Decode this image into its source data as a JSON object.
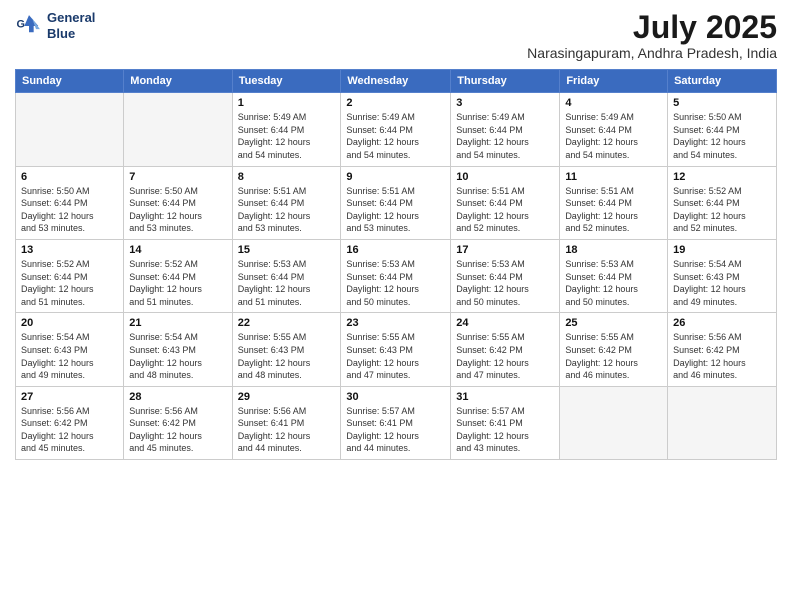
{
  "logo": {
    "line1": "General",
    "line2": "Blue"
  },
  "title": "July 2025",
  "location": "Narasingapuram, Andhra Pradesh, India",
  "days_of_week": [
    "Sunday",
    "Monday",
    "Tuesday",
    "Wednesday",
    "Thursday",
    "Friday",
    "Saturday"
  ],
  "weeks": [
    [
      {
        "day": "",
        "info": ""
      },
      {
        "day": "",
        "info": ""
      },
      {
        "day": "1",
        "info": "Sunrise: 5:49 AM\nSunset: 6:44 PM\nDaylight: 12 hours\nand 54 minutes."
      },
      {
        "day": "2",
        "info": "Sunrise: 5:49 AM\nSunset: 6:44 PM\nDaylight: 12 hours\nand 54 minutes."
      },
      {
        "day": "3",
        "info": "Sunrise: 5:49 AM\nSunset: 6:44 PM\nDaylight: 12 hours\nand 54 minutes."
      },
      {
        "day": "4",
        "info": "Sunrise: 5:49 AM\nSunset: 6:44 PM\nDaylight: 12 hours\nand 54 minutes."
      },
      {
        "day": "5",
        "info": "Sunrise: 5:50 AM\nSunset: 6:44 PM\nDaylight: 12 hours\nand 54 minutes."
      }
    ],
    [
      {
        "day": "6",
        "info": "Sunrise: 5:50 AM\nSunset: 6:44 PM\nDaylight: 12 hours\nand 53 minutes."
      },
      {
        "day": "7",
        "info": "Sunrise: 5:50 AM\nSunset: 6:44 PM\nDaylight: 12 hours\nand 53 minutes."
      },
      {
        "day": "8",
        "info": "Sunrise: 5:51 AM\nSunset: 6:44 PM\nDaylight: 12 hours\nand 53 minutes."
      },
      {
        "day": "9",
        "info": "Sunrise: 5:51 AM\nSunset: 6:44 PM\nDaylight: 12 hours\nand 53 minutes."
      },
      {
        "day": "10",
        "info": "Sunrise: 5:51 AM\nSunset: 6:44 PM\nDaylight: 12 hours\nand 52 minutes."
      },
      {
        "day": "11",
        "info": "Sunrise: 5:51 AM\nSunset: 6:44 PM\nDaylight: 12 hours\nand 52 minutes."
      },
      {
        "day": "12",
        "info": "Sunrise: 5:52 AM\nSunset: 6:44 PM\nDaylight: 12 hours\nand 52 minutes."
      }
    ],
    [
      {
        "day": "13",
        "info": "Sunrise: 5:52 AM\nSunset: 6:44 PM\nDaylight: 12 hours\nand 51 minutes."
      },
      {
        "day": "14",
        "info": "Sunrise: 5:52 AM\nSunset: 6:44 PM\nDaylight: 12 hours\nand 51 minutes."
      },
      {
        "day": "15",
        "info": "Sunrise: 5:53 AM\nSunset: 6:44 PM\nDaylight: 12 hours\nand 51 minutes."
      },
      {
        "day": "16",
        "info": "Sunrise: 5:53 AM\nSunset: 6:44 PM\nDaylight: 12 hours\nand 50 minutes."
      },
      {
        "day": "17",
        "info": "Sunrise: 5:53 AM\nSunset: 6:44 PM\nDaylight: 12 hours\nand 50 minutes."
      },
      {
        "day": "18",
        "info": "Sunrise: 5:53 AM\nSunset: 6:44 PM\nDaylight: 12 hours\nand 50 minutes."
      },
      {
        "day": "19",
        "info": "Sunrise: 5:54 AM\nSunset: 6:43 PM\nDaylight: 12 hours\nand 49 minutes."
      }
    ],
    [
      {
        "day": "20",
        "info": "Sunrise: 5:54 AM\nSunset: 6:43 PM\nDaylight: 12 hours\nand 49 minutes."
      },
      {
        "day": "21",
        "info": "Sunrise: 5:54 AM\nSunset: 6:43 PM\nDaylight: 12 hours\nand 48 minutes."
      },
      {
        "day": "22",
        "info": "Sunrise: 5:55 AM\nSunset: 6:43 PM\nDaylight: 12 hours\nand 48 minutes."
      },
      {
        "day": "23",
        "info": "Sunrise: 5:55 AM\nSunset: 6:43 PM\nDaylight: 12 hours\nand 47 minutes."
      },
      {
        "day": "24",
        "info": "Sunrise: 5:55 AM\nSunset: 6:42 PM\nDaylight: 12 hours\nand 47 minutes."
      },
      {
        "day": "25",
        "info": "Sunrise: 5:55 AM\nSunset: 6:42 PM\nDaylight: 12 hours\nand 46 minutes."
      },
      {
        "day": "26",
        "info": "Sunrise: 5:56 AM\nSunset: 6:42 PM\nDaylight: 12 hours\nand 46 minutes."
      }
    ],
    [
      {
        "day": "27",
        "info": "Sunrise: 5:56 AM\nSunset: 6:42 PM\nDaylight: 12 hours\nand 45 minutes."
      },
      {
        "day": "28",
        "info": "Sunrise: 5:56 AM\nSunset: 6:42 PM\nDaylight: 12 hours\nand 45 minutes."
      },
      {
        "day": "29",
        "info": "Sunrise: 5:56 AM\nSunset: 6:41 PM\nDaylight: 12 hours\nand 44 minutes."
      },
      {
        "day": "30",
        "info": "Sunrise: 5:57 AM\nSunset: 6:41 PM\nDaylight: 12 hours\nand 44 minutes."
      },
      {
        "day": "31",
        "info": "Sunrise: 5:57 AM\nSunset: 6:41 PM\nDaylight: 12 hours\nand 43 minutes."
      },
      {
        "day": "",
        "info": ""
      },
      {
        "day": "",
        "info": ""
      }
    ]
  ]
}
